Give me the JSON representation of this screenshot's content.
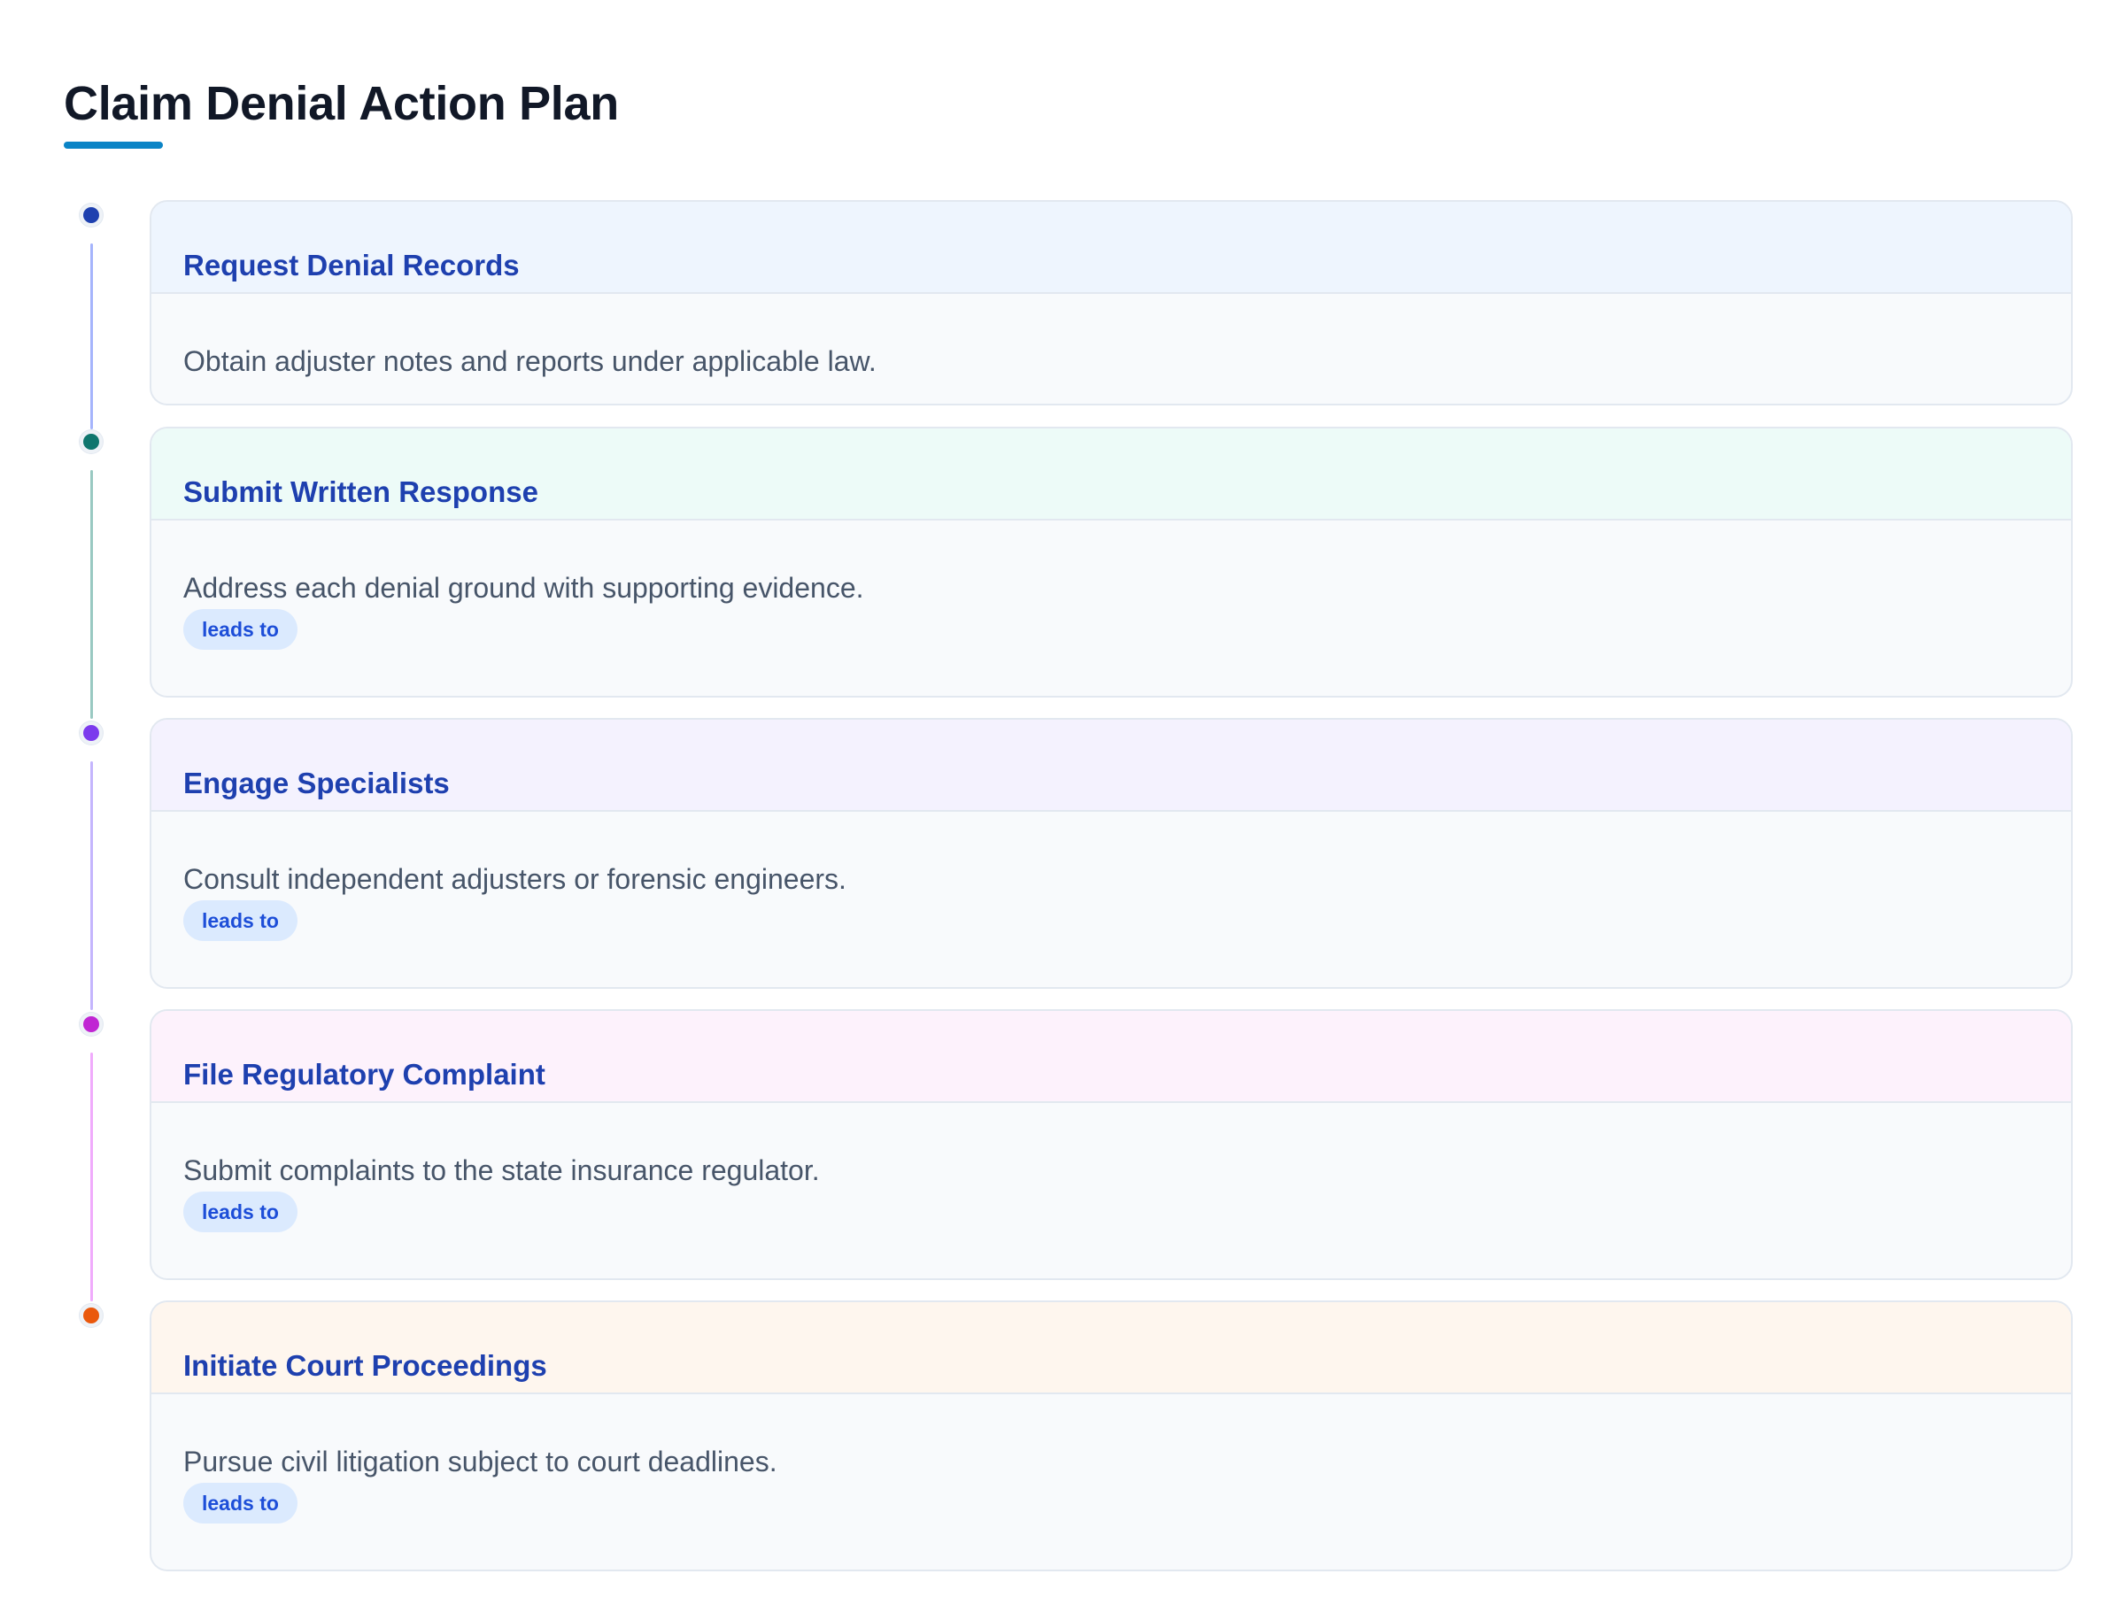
{
  "page": {
    "title": "Claim Denial Action Plan",
    "accent_color": "#0b84c6"
  },
  "steps": [
    {
      "title": "Request Denial Records",
      "description": "Obtain adjuster notes and reports under applicable law.",
      "badge": "",
      "dot_color": "#1e40af",
      "header_bg": "#eef5fe",
      "connector_color": "#a5b4fc"
    },
    {
      "title": "Submit Written Response",
      "description": "Address each denial ground with supporting evidence.",
      "badge": "leads to",
      "dot_color": "#0f766e",
      "header_bg": "#edfbf8",
      "connector_color": "#99c9c2"
    },
    {
      "title": "Engage Specialists",
      "description": "Consult independent adjusters or forensic engineers.",
      "badge": "leads to",
      "dot_color": "#7c3aed",
      "header_bg": "#f4f2fe",
      "connector_color": "#c4b5fd"
    },
    {
      "title": "File Regulatory Complaint",
      "description": "Submit complaints to the state insurance regulator.",
      "badge": "leads to",
      "dot_color": "#c026d3",
      "header_bg": "#fdf2fc",
      "connector_color": "#f0abfc"
    },
    {
      "title": "Initiate Court Proceedings",
      "description": "Pursue civil litigation subject to court deadlines.",
      "badge": "leads to",
      "dot_color": "#ea580c",
      "header_bg": "#fef6ee",
      "connector_color": ""
    }
  ]
}
